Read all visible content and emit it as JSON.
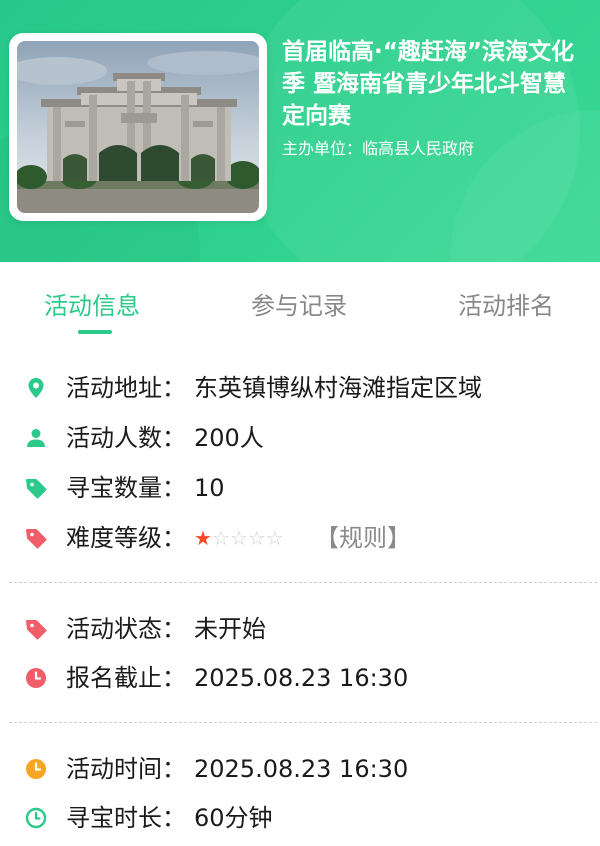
{
  "event": {
    "title": "首届临高·“趣赶海”滨海文化季 暨海南省青少年北斗智慧定向赛",
    "organizer": "主办单位：临高县人民政府"
  },
  "tabs": [
    {
      "label": "活动信息",
      "active": true
    },
    {
      "label": "参与记录",
      "active": false
    },
    {
      "label": "活动排名",
      "active": false
    }
  ],
  "info": {
    "address": {
      "label": "活动地址：",
      "value": "东英镇博纵村海滩指定区域",
      "icon": "location-pin-icon",
      "color": "#2bc98a"
    },
    "participants": {
      "label": "活动人数：",
      "value": "200人",
      "icon": "person-icon",
      "color": "#2bc98a"
    },
    "treasure_count": {
      "label": "寻宝数量：",
      "value": "10",
      "icon": "tag-icon",
      "color": "#2bc98a"
    },
    "difficulty": {
      "label": "难度等级：",
      "rating": 1,
      "max": 5,
      "rule_link": "【规则】",
      "icon": "tag-icon",
      "color": "#f25d6a"
    }
  },
  "status": {
    "state": {
      "label": "活动状态：",
      "value": "未开始",
      "icon": "tag-icon",
      "color": "#f25d6a"
    },
    "deadline": {
      "label": "报名截止：",
      "value": "2025.08.23 16:30",
      "icon": "clock-icon",
      "color": "#f25d6a"
    }
  },
  "timing": {
    "time": {
      "label": "活动时间：",
      "value": "2025.08.23 16:30",
      "icon": "clock-icon",
      "color": "#f5a623"
    },
    "duration": {
      "label": "寻宝时长：",
      "value": "60分钟",
      "icon": "clock-outline-icon",
      "color": "#2bc98a"
    }
  },
  "colors": {
    "primary": "#2bc98a",
    "danger": "#f25d6a",
    "warning": "#f5a623",
    "muted": "#888888"
  }
}
